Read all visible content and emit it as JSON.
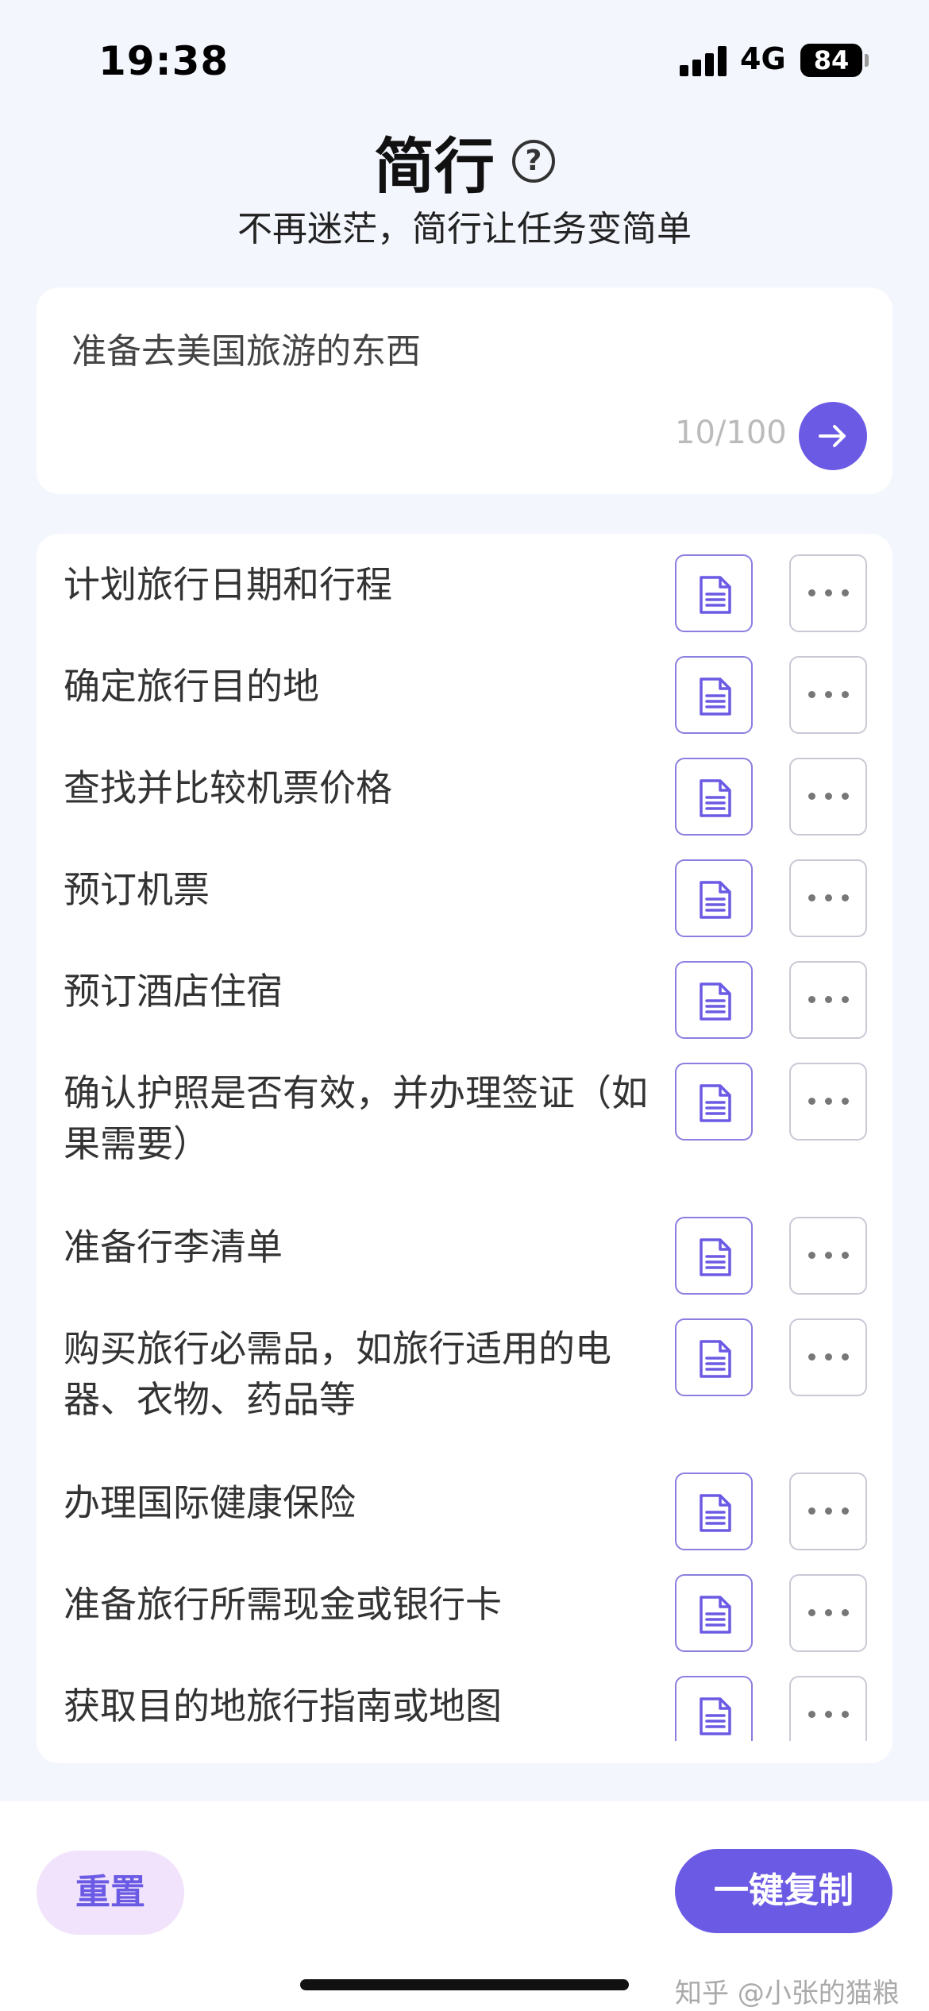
{
  "status_bar": {
    "time": "19:38",
    "network": "4G",
    "battery": "84"
  },
  "header": {
    "title": "简行",
    "help_icon": "question-circle-icon",
    "subtitle": "不再迷茫，简行让任务变简单"
  },
  "input": {
    "value": "准备去美国旅游的东西",
    "char_count": "10/100",
    "send_icon": "arrow-right-icon"
  },
  "tasks": [
    {
      "label": "计划旅行日期和行程"
    },
    {
      "label": "确定旅行目的地"
    },
    {
      "label": "查找并比较机票价格"
    },
    {
      "label": "预订机票"
    },
    {
      "label": "预订酒店住宿"
    },
    {
      "label": "确认护照是否有效，并办理签证（如果需要）"
    },
    {
      "label": "准备行李清单"
    },
    {
      "label": "购买旅行必需品，如旅行适用的电器、衣物、药品等"
    },
    {
      "label": "办理国际健康保险"
    },
    {
      "label": "准备旅行所需现金或银行卡"
    },
    {
      "label": "获取目的地旅行指南或地图"
    }
  ],
  "task_icons": {
    "doc": "document-icon",
    "more": "more-dots-icon"
  },
  "bottom": {
    "reset_label": "重置",
    "copy_label": "一键复制",
    "watermark": "知乎 @小张的猫粮"
  },
  "colors": {
    "accent": "#6b5ae4",
    "accent_light": "#f1e3fb",
    "background": "#f3f6fd"
  }
}
